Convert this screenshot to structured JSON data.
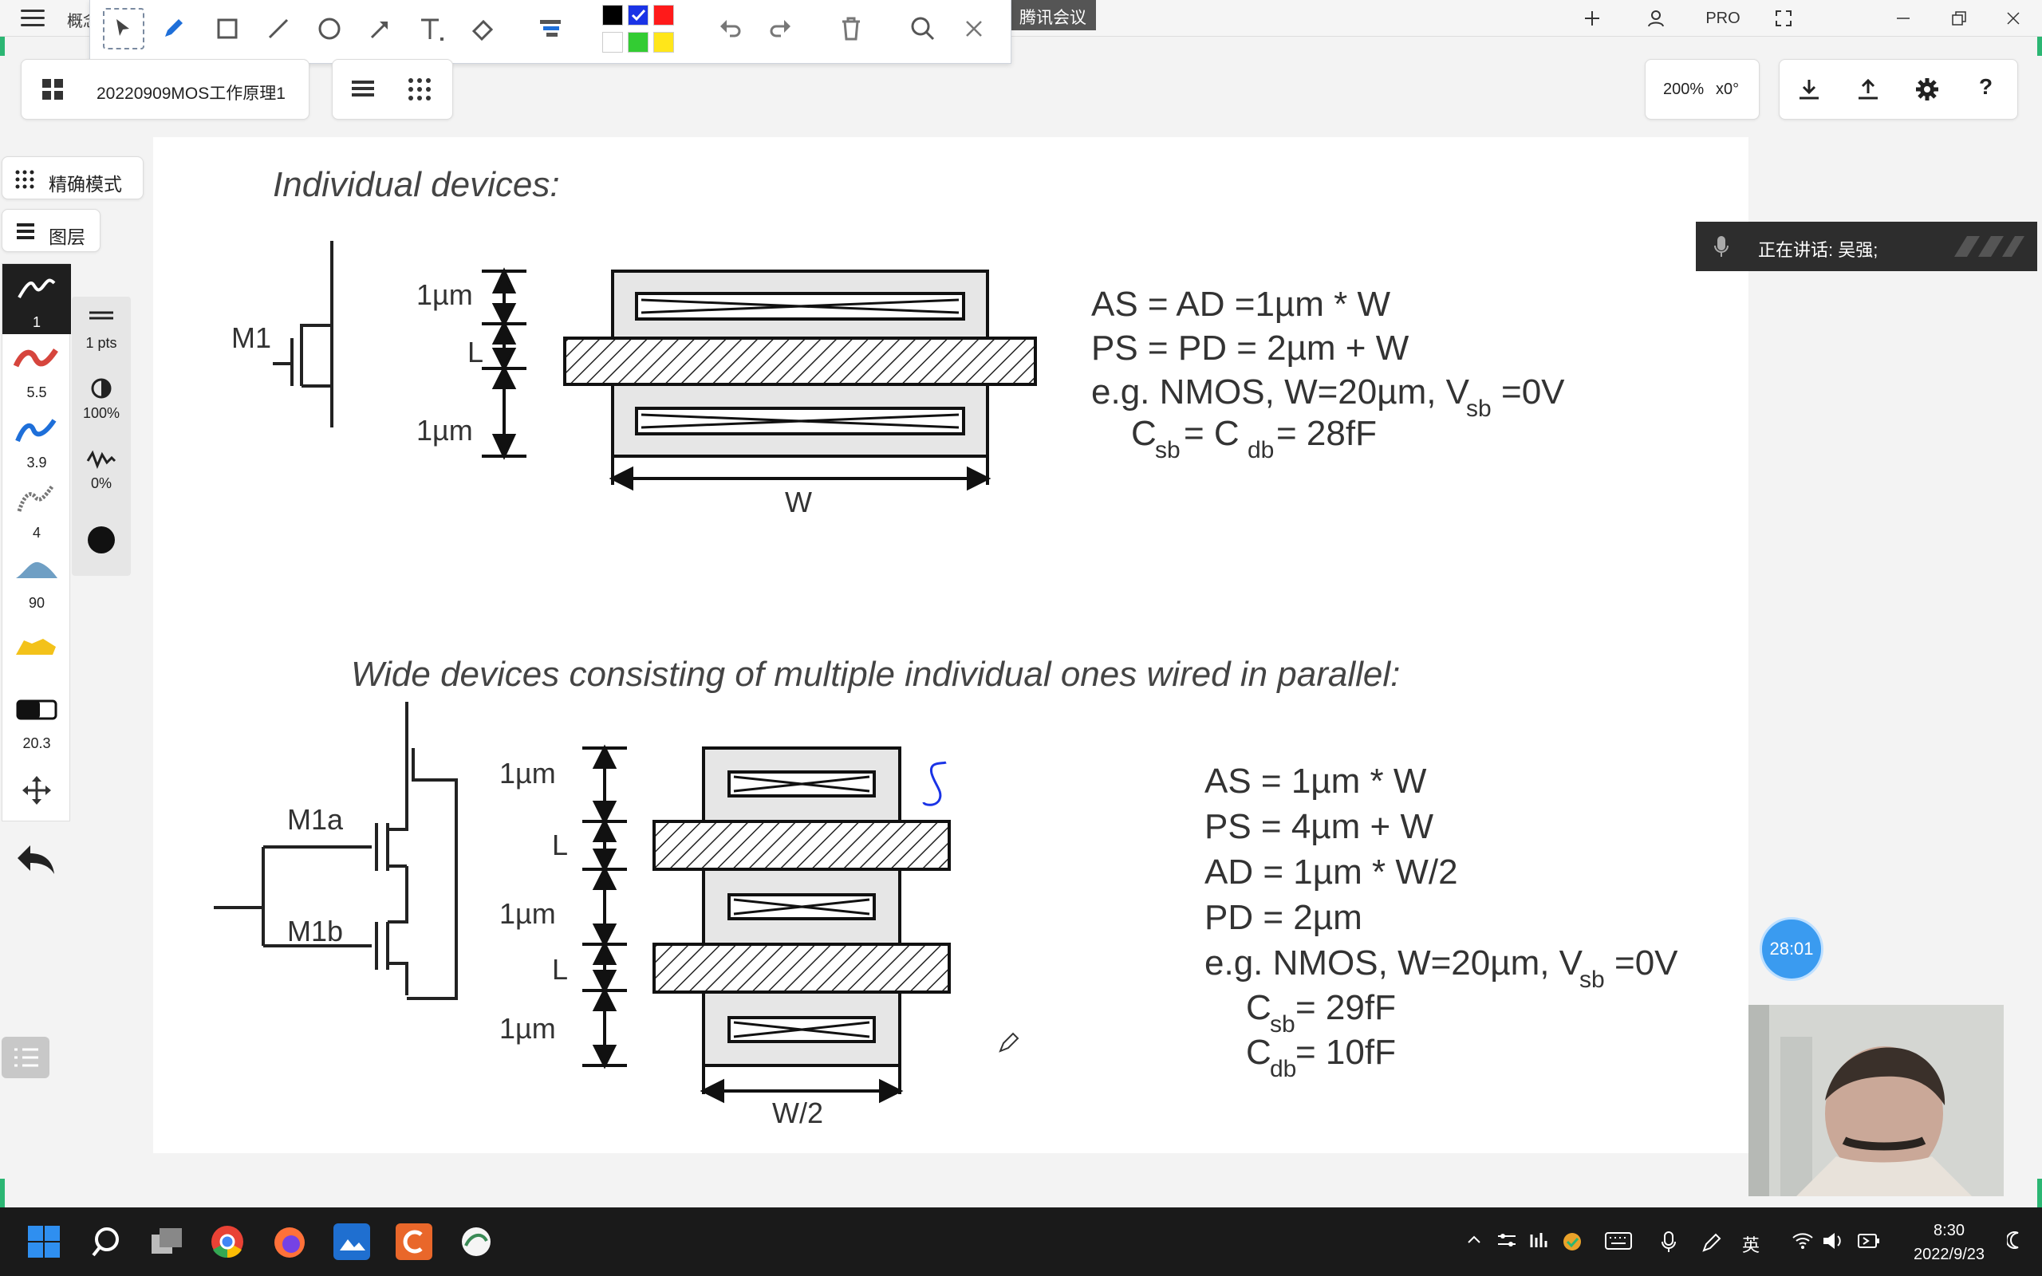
{
  "titlebar": {
    "doc_fragment": "概念",
    "meeting_label": "腾讯会议",
    "pro_label": "PRO"
  },
  "doc": {
    "title": "20220909MOS工作原理1",
    "zoom": "200%",
    "rotation": "x0°"
  },
  "modes": {
    "precise": "精确模式",
    "layers": "图层"
  },
  "colors": {
    "swatches": [
      "#000000",
      "#1a33e6",
      "#ff1a1a",
      "#ffffff",
      "#33cc33",
      "#ffe61a"
    ],
    "selected_swatch": "#1a33e6",
    "accent": "#3a9bf0"
  },
  "pens": [
    {
      "icon": "pen-stroke-black-icon",
      "value": "1"
    },
    {
      "icon": "pen-stroke-red-icon",
      "value": "5.5"
    },
    {
      "icon": "pen-stroke-blue-icon",
      "value": "3.9"
    },
    {
      "icon": "pencil-texture-icon",
      "value": "4"
    },
    {
      "icon": "brush-blue-icon",
      "value": "90"
    },
    {
      "icon": "highlighter-yellow-icon",
      "value": ""
    },
    {
      "icon": "eraser-icon",
      "value": "20.3"
    }
  ],
  "pen_props": {
    "width": "1 pts",
    "opacity": "100%",
    "smoothing": "0%"
  },
  "slide": {
    "heading1": "Individual devices:",
    "m1": "M1",
    "dim_1um": "1µm",
    "dim_L": "L",
    "dim_W": "W",
    "eq1": "AS = AD =1µm * W",
    "eq2": "PS = PD = 2µm + W",
    "eq3_main": "e.g. NMOS, W=20µm, V",
    "eq3_sub": "sb",
    "eq3_tail": "=0V",
    "eq4_c": "C",
    "eq4_sb": "sb",
    "eq4_mid": " = C",
    "eq4_db": "db",
    "eq4_val": " = 28fF",
    "heading2": "Wide devices consisting of multiple individual ones wired in parallel:",
    "m1a": "M1a",
    "m1b": "M1b",
    "dim_W2": "W/2",
    "eqb1": "AS = 1µm * W",
    "eqb2": "PS = 4µm + W",
    "eqb3": "AD = 1µm * W/2",
    "eqb4": "PD = 2µm",
    "eqb5_main": "e.g. NMOS, W=20µm, V",
    "eqb5_sub": "sb",
    "eqb5_tail": "=0V",
    "eqb6_val": " = 29fF",
    "eqb7_val": " = 10fF",
    "c_letter": "C",
    "sb": "sb",
    "db": "db"
  },
  "meeting": {
    "talking": "正在讲话: 吴强;",
    "timer": "28:01"
  },
  "taskbar": {
    "ime": "英",
    "time": "8:30",
    "date": "2022/9/23"
  }
}
